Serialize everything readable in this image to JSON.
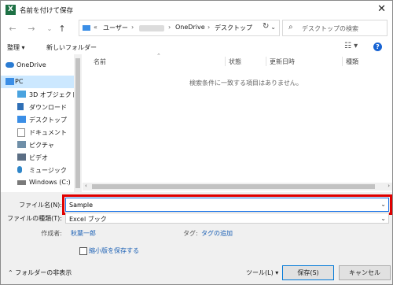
{
  "window": {
    "title": "名前を付けて保存",
    "close_glyph": "✕",
    "app_icon_letter": "X"
  },
  "nav": {
    "back": "←",
    "forward": "→",
    "recent": "⌄",
    "up": "↑"
  },
  "address": {
    "parts": [
      "ユーザー",
      "OneDrive",
      "デスクトップ"
    ],
    "lead": "«",
    "sep": "›",
    "chevron": "⌄"
  },
  "refresh_glyph": "↻",
  "search": {
    "placeholder": "デスクトップの検索",
    "icon": "search-icon"
  },
  "toolbar": {
    "organize": "整理 ▾",
    "new_folder": "新しいフォルダー",
    "view": "☷ ▾",
    "help": "?"
  },
  "sidebar": {
    "items": [
      {
        "label": "OneDrive",
        "icon": "cloud-icon",
        "color": "#2b7cd3"
      },
      {
        "label": "PC",
        "icon": "computer-icon",
        "color": "#3b8ee6"
      },
      {
        "label": "3D オブジェクト",
        "icon": "cube-icon",
        "color": "#4aa3df"
      },
      {
        "label": "ダウンロード",
        "icon": "download-icon",
        "color": "#2f6fb6"
      },
      {
        "label": "デスクトップ",
        "icon": "desktop-icon",
        "color": "#3b8ee6"
      },
      {
        "label": "ドキュメント",
        "icon": "document-icon",
        "color": "#8c8c8c"
      },
      {
        "label": "ピクチャ",
        "icon": "picture-icon",
        "color": "#6f8fa8"
      },
      {
        "label": "ビデオ",
        "icon": "video-icon",
        "color": "#5b6e84"
      },
      {
        "label": "ミュージック",
        "icon": "music-icon",
        "color": "#2f86c9"
      },
      {
        "label": "Windows (C:)",
        "icon": "drive-icon",
        "color": "#7a7a7a"
      }
    ]
  },
  "columns": {
    "name": "名前",
    "status": "状態",
    "modified": "更新日時",
    "type": "種類"
  },
  "empty_message": "検索条件に一致する項目はありません。",
  "form": {
    "filename_label": "ファイル名(N):",
    "filename_value": "Sample",
    "filetype_label": "ファイルの種類(T):",
    "filetype_value": "Excel ブック",
    "author_label": "作成者:",
    "author_value": "秋葉一郎",
    "tags_label": "タグ:",
    "tags_value": "タグの追加",
    "thumbnail_label": "縮小版を保存する",
    "hide_folders": "フォルダーの非表示",
    "tools": "ツール(L)",
    "save": "保存(S)",
    "cancel": "キャンセル"
  },
  "colors": {
    "highlight": "#e00000",
    "selected": "#cce8ff",
    "accent": "#0078d7"
  }
}
